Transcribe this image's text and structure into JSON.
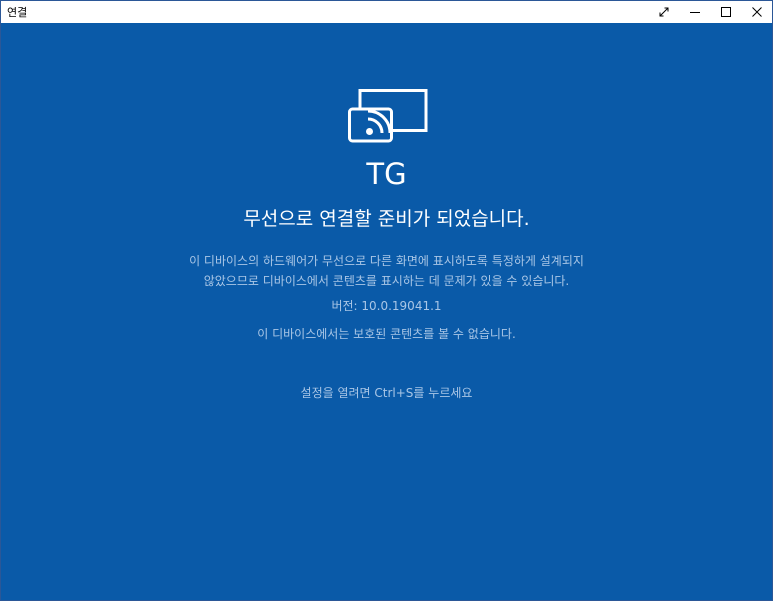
{
  "window": {
    "title": "연결"
  },
  "titlebar": {
    "icons": {
      "expand": "expand-diagonal-icon",
      "minimize": "minimize-icon",
      "maximize": "maximize-icon",
      "close": "close-icon"
    }
  },
  "main": {
    "cast_icon": "wireless-display-icon",
    "device_name": "TG",
    "headline": "무선으로 연결할 준비가 되었습니다.",
    "description_line1": "이 디바이스의 하드웨어가 무선으로 다른 화면에 표시하도록 특정하게 설계되지",
    "description_line2": "않았으므로 디바이스에서 콘텐츠를 표시하는 데 문제가 있을 수 있습니다.",
    "version": "버전: 10.0.19041.1",
    "protected_content": "이 디바이스에서는 보호된 콘텐츠를 볼 수 없습니다.",
    "settings_hint": "설정을 열려면 Ctrl+S를 누르세요"
  },
  "colors": {
    "background": "#0a5aa8",
    "primary_text": "#ffffff",
    "secondary_text": "#a9c6e6",
    "titlebar": "#ffffff"
  }
}
